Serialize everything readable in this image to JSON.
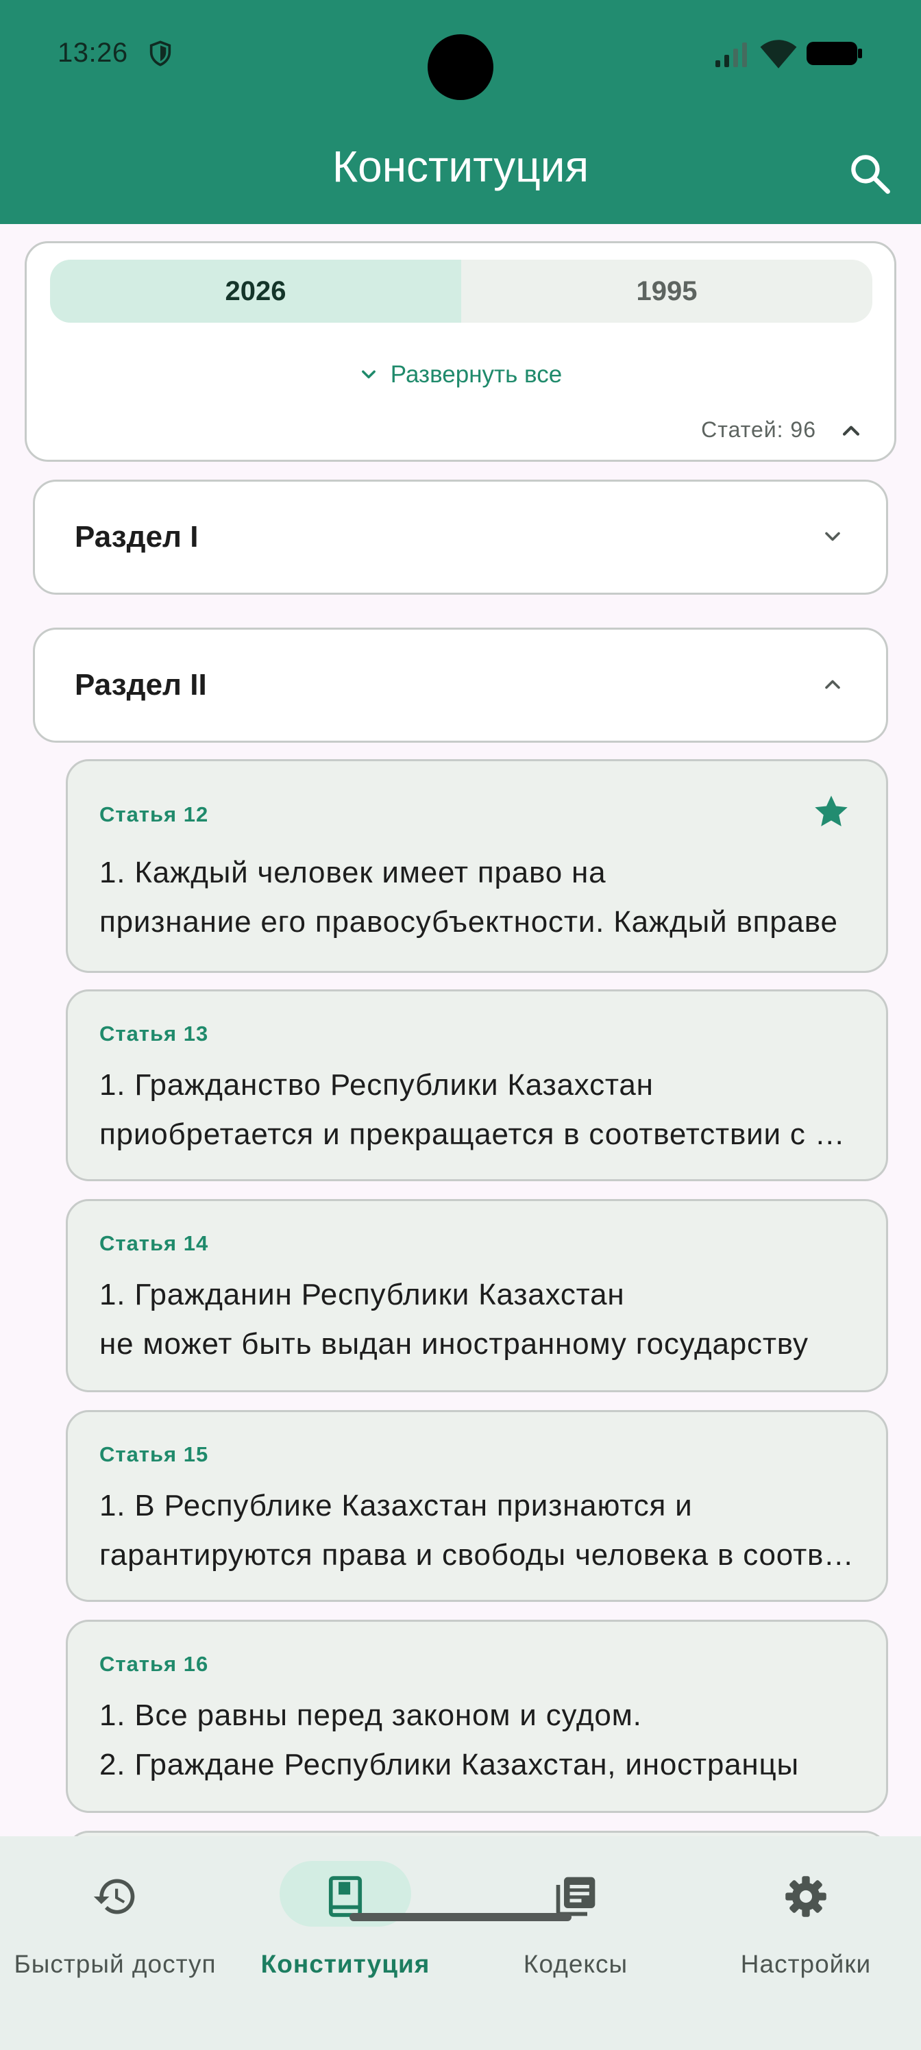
{
  "status_bar": {
    "time": "13:26"
  },
  "app_bar": {
    "title": "Конституция"
  },
  "filter": {
    "years": [
      {
        "label": "2026",
        "selected": true
      },
      {
        "label": "1995",
        "selected": false
      }
    ],
    "expand_all_label": "Развернуть все",
    "count_label": "Статей: 96"
  },
  "sections": [
    {
      "title": "Раздел I",
      "expanded": false
    },
    {
      "title": "Раздел II",
      "expanded": true
    }
  ],
  "articles": [
    {
      "number": "Статья 12",
      "line1": "1. Каждый человек имеет право на",
      "line2": "признание его правосубъектности. Каждый вправе",
      "favorite": true
    },
    {
      "number": "Статья 13",
      "line1": "1. Гражданство Республики Казахстан",
      "line2": "приобретается и прекращается в соответствии с законом",
      "favorite": false
    },
    {
      "number": "Статья 14",
      "line1": "1. Гражданин Республики Казахстан",
      "line2": "не может быть выдан иностранному государству",
      "favorite": false
    },
    {
      "number": "Статья 15",
      "line1": "1. В Республике Казахстан признаются и",
      "line2": "гарантируются права и свободы человека в соответствии",
      "favorite": false
    },
    {
      "number": "Статья 16",
      "line1": "1. Все равны перед законом и судом.",
      "line2": "2. Граждане Республики Казахстан, иностранцы",
      "favorite": false
    }
  ],
  "bottom_nav": [
    {
      "label": "Быстрый доступ",
      "icon": "history-icon",
      "active": false
    },
    {
      "label": "Конституция",
      "icon": "book-icon",
      "active": true
    },
    {
      "label": "Кодексы",
      "icon": "library-books-icon",
      "active": false
    },
    {
      "label": "Настройки",
      "icon": "gear-icon",
      "active": false
    }
  ],
  "colors": {
    "primary": "#228c70",
    "accent_text": "#1f8a6b",
    "selected_container": "#d3ede3",
    "card_surface": "#edf1ed",
    "background": "#fcf6fc"
  }
}
